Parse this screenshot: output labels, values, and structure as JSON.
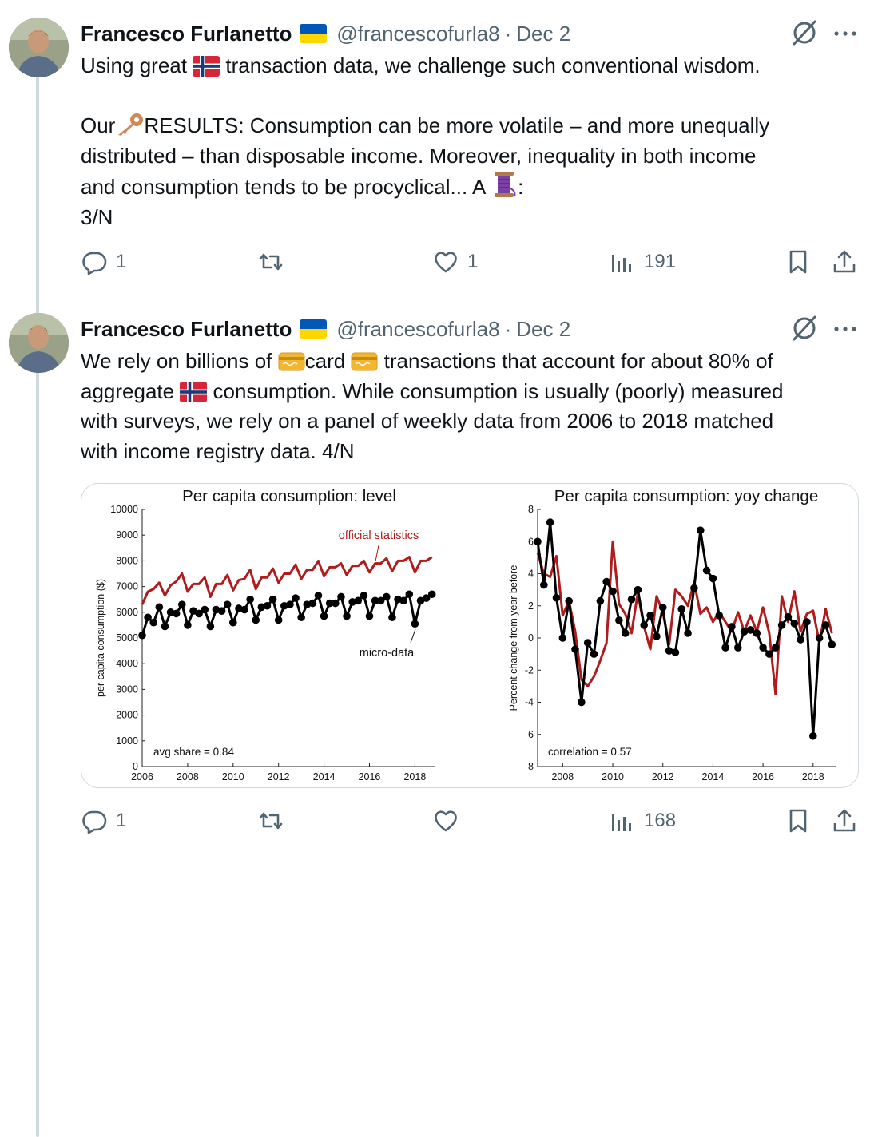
{
  "tweets": [
    {
      "author_name": "Francesco Furlanetto",
      "handle": "@francescofurla8",
      "separator": "·",
      "date": "Dec 2",
      "text": {
        "l1a": "Using great ",
        "l1b": " transaction data, we challenge such conventional wisdom.",
        "l3a": "Our",
        "l3b": "RESULTS: Consumption can be more volatile – and more unequally",
        "l4": "distributed – than disposable income. Moreover, inequality in both income",
        "l5a": "and consumption tends to be procyclical... A ",
        "l5b": ":",
        "l6": "3/N"
      },
      "stats": {
        "replies": "1",
        "reposts": "",
        "likes": "1",
        "views": "191"
      }
    },
    {
      "author_name": "Francesco Furlanetto",
      "handle": "@francescofurla8",
      "separator": "·",
      "date": "Dec 2",
      "text": {
        "l1a": "We rely on billions of ",
        "l1b": "card ",
        "l1c": " transactions that account for about 80% of",
        "l2a": "aggregate ",
        "l2b": " consumption. While consumption is usually (poorly) measured",
        "l3": "with surveys, we rely on a panel of weekly data from 2006 to 2018 matched",
        "l4": "with income registry data. 4/N"
      },
      "stats": {
        "replies": "1",
        "reposts": "",
        "likes": "",
        "views": "168"
      }
    }
  ],
  "colors": {
    "official": "#b01c1c",
    "micro": "#000000",
    "muted": "#536471",
    "flag_ua_blue": "#0057b7",
    "flag_ua_yellow": "#ffd700"
  },
  "icons": [
    "reply-icon",
    "repost-icon",
    "like-icon",
    "views-icon",
    "bookmark-icon",
    "share-icon",
    "grok-icon",
    "more-icon",
    "norway-flag",
    "ukraine-flag",
    "key-emoji",
    "thread-spool-emoji",
    "credit-card-emoji"
  ],
  "chart_data": [
    {
      "type": "line",
      "title": "Per capita consumption: level",
      "xlabel": "",
      "ylabel": "per capita consumption ($)",
      "xlim": [
        2006,
        2018.9
      ],
      "ylim": [
        0,
        10000
      ],
      "x_ticks": [
        "2006",
        "2008",
        "2010",
        "2012",
        "2014",
        "2016",
        "2018"
      ],
      "y_ticks": [
        "0",
        "1000",
        "2000",
        "3000",
        "4000",
        "5000",
        "6000",
        "7000",
        "8000",
        "9000",
        "10000"
      ],
      "annotations": [
        "official statistics",
        "micro-data",
        "avg share = 0.84"
      ],
      "series": [
        {
          "name": "official statistics",
          "color": "#b01c1c",
          "markers": false,
          "x": [
            2006.0,
            2006.25,
            2006.5,
            2006.75,
            2007.0,
            2007.25,
            2007.5,
            2007.75,
            2008.0,
            2008.25,
            2008.5,
            2008.75,
            2009.0,
            2009.25,
            2009.5,
            2009.75,
            2010.0,
            2010.25,
            2010.5,
            2010.75,
            2011.0,
            2011.25,
            2011.5,
            2011.75,
            2012.0,
            2012.25,
            2012.5,
            2012.75,
            2013.0,
            2013.25,
            2013.5,
            2013.75,
            2014.0,
            2014.25,
            2014.5,
            2014.75,
            2015.0,
            2015.25,
            2015.5,
            2015.75,
            2016.0,
            2016.25,
            2016.5,
            2016.75,
            2017.0,
            2017.25,
            2017.5,
            2017.75,
            2018.0,
            2018.25,
            2018.5,
            2018.75
          ],
          "y": [
            6300,
            6800,
            6900,
            7150,
            6650,
            7050,
            7200,
            7500,
            6800,
            7100,
            7100,
            7350,
            6600,
            7100,
            7100,
            7450,
            6850,
            7250,
            7300,
            7650,
            6900,
            7350,
            7350,
            7700,
            7150,
            7500,
            7500,
            7850,
            7300,
            7650,
            7650,
            8000,
            7400,
            7750,
            7750,
            7900,
            7450,
            7800,
            7800,
            8000,
            7550,
            7900,
            7900,
            8100,
            7600,
            8000,
            8000,
            8150,
            7550,
            8000,
            8000,
            8150
          ]
        },
        {
          "name": "micro-data",
          "color": "#000000",
          "markers": true,
          "x": [
            2006.0,
            2006.25,
            2006.5,
            2006.75,
            2007.0,
            2007.25,
            2007.5,
            2007.75,
            2008.0,
            2008.25,
            2008.5,
            2008.75,
            2009.0,
            2009.25,
            2009.5,
            2009.75,
            2010.0,
            2010.25,
            2010.5,
            2010.75,
            2011.0,
            2011.25,
            2011.5,
            2011.75,
            2012.0,
            2012.25,
            2012.5,
            2012.75,
            2013.0,
            2013.25,
            2013.5,
            2013.75,
            2014.0,
            2014.25,
            2014.5,
            2014.75,
            2015.0,
            2015.25,
            2015.5,
            2015.75,
            2016.0,
            2016.25,
            2016.5,
            2016.75,
            2017.0,
            2017.25,
            2017.5,
            2017.75,
            2018.0,
            2018.25,
            2018.5,
            2018.75
          ],
          "y": [
            5100,
            5800,
            5600,
            6200,
            5450,
            6000,
            5950,
            6300,
            5500,
            6050,
            5950,
            6100,
            5450,
            6100,
            6050,
            6300,
            5600,
            6150,
            6100,
            6500,
            5700,
            6200,
            6250,
            6500,
            5700,
            6250,
            6300,
            6550,
            5800,
            6300,
            6350,
            6650,
            5850,
            6350,
            6350,
            6600,
            5850,
            6400,
            6450,
            6650,
            5850,
            6450,
            6450,
            6600,
            5800,
            6500,
            6450,
            6700,
            5550,
            6450,
            6550,
            6700
          ]
        }
      ]
    },
    {
      "type": "line",
      "title": "Per capita consumption: yoy change",
      "xlabel": "",
      "ylabel": "Percent change from year before",
      "xlim": [
        2007,
        2018.9
      ],
      "ylim": [
        -8,
        8
      ],
      "x_ticks": [
        "2008",
        "2010",
        "2012",
        "2014",
        "2016",
        "2018"
      ],
      "y_ticks": [
        "-8",
        "-6",
        "-4",
        "-2",
        "0",
        "2",
        "4",
        "6",
        "8"
      ],
      "annotations": [
        "correlation = 0.57"
      ],
      "series": [
        {
          "name": "official statistics",
          "color": "#b01c1c",
          "markers": false,
          "x": [
            2007.0,
            2007.25,
            2007.5,
            2007.75,
            2008.0,
            2008.25,
            2008.5,
            2008.75,
            2009.0,
            2009.25,
            2009.5,
            2009.75,
            2010.0,
            2010.25,
            2010.5,
            2010.75,
            2011.0,
            2011.25,
            2011.5,
            2011.75,
            2012.0,
            2012.25,
            2012.5,
            2012.75,
            2013.0,
            2013.25,
            2013.5,
            2013.75,
            2014.0,
            2014.25,
            2014.5,
            2014.75,
            2015.0,
            2015.25,
            2015.5,
            2015.75,
            2016.0,
            2016.25,
            2016.5,
            2016.75,
            2017.0,
            2017.25,
            2017.5,
            2017.75,
            2018.0,
            2018.25,
            2018.5,
            2018.75
          ],
          "y": [
            5.3,
            4.0,
            3.8,
            5.1,
            1.4,
            2.3,
            0.4,
            -2.6,
            -3.0,
            -2.4,
            -1.4,
            -0.3,
            6.0,
            2.1,
            1.5,
            0.3,
            2.8,
            0.7,
            -0.7,
            2.6,
            1.6,
            -0.4,
            3.0,
            2.6,
            2.0,
            3.5,
            1.5,
            1.9,
            1.0,
            1.6,
            1.0,
            0.4,
            1.6,
            0.4,
            1.4,
            0.4,
            1.9,
            0.3,
            -3.5,
            2.6,
            1.0,
            2.9,
            0.4,
            1.5,
            1.7,
            -0.3,
            1.8,
            0.3
          ]
        },
        {
          "name": "micro-data",
          "color": "#000000",
          "markers": true,
          "x": [
            2007.0,
            2007.25,
            2007.5,
            2007.75,
            2008.0,
            2008.25,
            2008.5,
            2008.75,
            2009.0,
            2009.25,
            2009.5,
            2009.75,
            2010.0,
            2010.25,
            2010.5,
            2010.75,
            2011.0,
            2011.25,
            2011.5,
            2011.75,
            2012.0,
            2012.25,
            2012.5,
            2012.75,
            2013.0,
            2013.25,
            2013.5,
            2013.75,
            2014.0,
            2014.25,
            2014.5,
            2014.75,
            2015.0,
            2015.25,
            2015.5,
            2015.75,
            2016.0,
            2016.25,
            2016.5,
            2016.75,
            2017.0,
            2017.25,
            2017.5,
            2017.75,
            2018.0,
            2018.25,
            2018.5,
            2018.75
          ],
          "y": [
            6.0,
            3.3,
            7.2,
            2.5,
            0.0,
            2.3,
            -0.7,
            -4.0,
            -0.3,
            -1.0,
            2.3,
            3.5,
            2.9,
            1.1,
            0.3,
            2.4,
            3.0,
            0.8,
            1.4,
            0.1,
            1.9,
            -0.8,
            -0.9,
            1.8,
            0.3,
            3.1,
            6.7,
            4.2,
            3.7,
            1.4,
            -0.6,
            0.7,
            -0.6,
            0.4,
            0.5,
            0.3,
            -0.6,
            -1.0,
            -0.6,
            0.8,
            1.3,
            0.9,
            -0.1,
            1.0,
            -6.1,
            0.0,
            0.8,
            -0.4
          ]
        }
      ]
    }
  ]
}
